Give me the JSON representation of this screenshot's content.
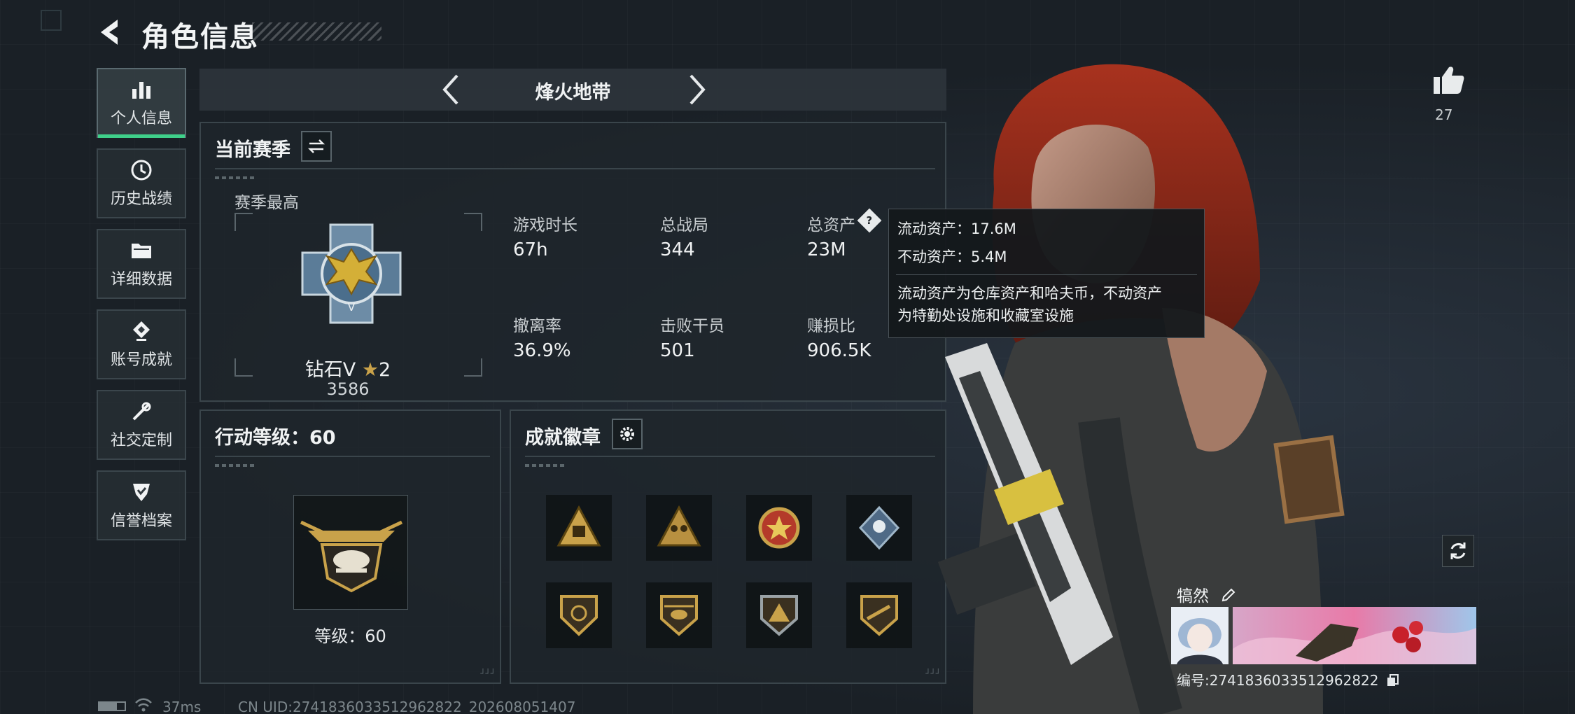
{
  "header": {
    "title": "角色信息"
  },
  "sidebar": {
    "items": [
      {
        "label": "个人信息",
        "icon": "bar-chart-icon",
        "active": true
      },
      {
        "label": "历史战绩",
        "icon": "history-icon"
      },
      {
        "label": "详细数据",
        "icon": "folder-icon"
      },
      {
        "label": "账号成就",
        "icon": "achievement-icon"
      },
      {
        "label": "社交定制",
        "icon": "tools-icon"
      },
      {
        "label": "信誉档案",
        "icon": "shield-check-icon"
      }
    ]
  },
  "mode": {
    "title": "烽火地带"
  },
  "season": {
    "title": "当前赛季",
    "best_label": "赛季最高",
    "rank_name": "钻石V",
    "rank_stars": "2",
    "rank_score": "3586",
    "stats": [
      {
        "label": "游戏时长",
        "value": "67h"
      },
      {
        "label": "总战局",
        "value": "344"
      },
      {
        "label": "总资产",
        "value": "23M"
      },
      {
        "label": "撤离率",
        "value": "36.9%"
      },
      {
        "label": "击败干员",
        "value": "501"
      },
      {
        "label": "赚损比",
        "value": "906.5K"
      }
    ]
  },
  "tooltip": {
    "line1": "流动资产：17.6M",
    "line2": "不动资产：5.4M",
    "desc1": "流动资产为仓库资产和哈夫币，不动资产",
    "desc2": "为特勤处设施和收藏室设施"
  },
  "action_level": {
    "title": "行动等级：60",
    "level_text": "等级：60"
  },
  "achievements": {
    "title": "成就徽章",
    "badges": [
      "triangle-badge",
      "soldiers-badge",
      "star-cross-badge",
      "diamond-badge",
      "shield-badge",
      "helicopter-badge",
      "mountain-badge",
      "rifle-badge"
    ]
  },
  "player": {
    "likes": "27",
    "name": "犒然",
    "id": "编号:2741836033512962822"
  },
  "status_bar": {
    "ping": "37ms",
    "uid": "CN UID:2741836033512962822_202608051407"
  },
  "colors": {
    "accent": "#3fd08a",
    "gold": "#c9a24a",
    "tooltip_bg": "#14181b"
  }
}
